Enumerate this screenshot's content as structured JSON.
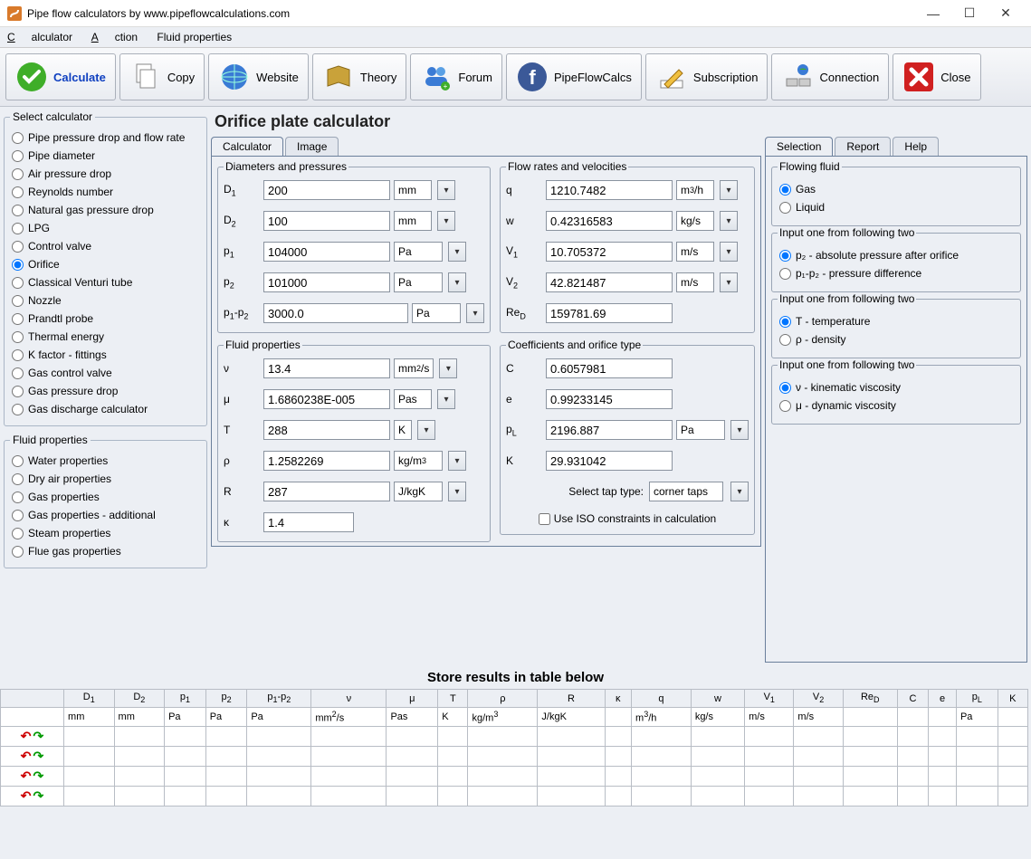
{
  "window": {
    "title": "Pipe flow calculators by www.pipeflowcalculations.com"
  },
  "menu": {
    "calculator": "Calculator",
    "action": "Action",
    "fluid": "Fluid properties"
  },
  "toolbar": {
    "calculate": "Calculate",
    "copy": "Copy",
    "website": "Website",
    "theory": "Theory",
    "forum": "Forum",
    "pipeflowcalcs": "PipeFlowCalcs",
    "subscription": "Subscription",
    "connection": "Connection",
    "close": "Close"
  },
  "sidebar": {
    "selectCalc": "Select calculator",
    "calcs": [
      "Pipe pressure drop and flow rate",
      "Pipe diameter",
      "Air pressure drop",
      "Reynolds number",
      "Natural gas pressure drop",
      "LPG",
      "Control valve",
      "Orifice",
      "Classical Venturi tube",
      "Nozzle",
      "Prandtl probe",
      "Thermal energy",
      "K factor - fittings",
      "Gas control valve",
      "Gas pressure drop",
      "Gas discharge calculator"
    ],
    "selectedCalc": "Orifice",
    "fluidProps": "Fluid properties",
    "fluids": [
      "Water properties",
      "Dry air properties",
      "Gas properties",
      "Gas properties - additional",
      "Steam properties",
      "Flue gas properties"
    ]
  },
  "main": {
    "title": "Orifice plate calculator",
    "tabCalc": "Calculator",
    "tabImage": "Image",
    "diameters": {
      "legend": "Diameters and pressures",
      "D1": "200",
      "D1u": "mm",
      "D2": "100",
      "D2u": "mm",
      "p1": "104000",
      "p1u": "Pa",
      "p2": "101000",
      "p2u": "Pa",
      "dp": "3000.0",
      "dpu": "Pa"
    },
    "flowrates": {
      "legend": "Flow rates and velocities",
      "q": "1210.7482",
      "qu": "m³/h",
      "w": "0.42316583",
      "wu": "kg/s",
      "V1": "10.705372",
      "V1u": "m/s",
      "V2": "42.821487",
      "V2u": "m/s",
      "ReD": "159781.69"
    },
    "fluidprops": {
      "legend": "Fluid properties",
      "nu": "13.4",
      "nuu": "mm²/s",
      "mu": "1.6860238E-005",
      "muu": "Pas",
      "T": "288",
      "Tu": "K",
      "rho": "1.2582269",
      "rhou": "kg/m³",
      "R": "287",
      "Ru": "J/kgK",
      "kappa": "1.4"
    },
    "coeffs": {
      "legend": "Coefficients and orifice type",
      "C": "0.6057981",
      "e": "0.99233145",
      "pL": "2196.887",
      "pLu": "Pa",
      "K": "29.931042",
      "taplabel": "Select tap type:",
      "tap": "corner taps",
      "iso": "Use ISO constraints in calculation"
    }
  },
  "right": {
    "tabSel": "Selection",
    "tabRep": "Report",
    "tabHelp": "Help",
    "flowing": "Flowing fluid",
    "gas": "Gas",
    "liquid": "Liquid",
    "inp1": "Input one from following two",
    "p2abs": "p₂ - absolute pressure after orifice",
    "pdiff": "p₁-p₂ - pressure difference",
    "inp2": "Input one from following two",
    "Ttemp": "T - temperature",
    "rhod": "ρ - density",
    "inp3": "Input one from following two",
    "nuk": "ν - kinematic viscosity",
    "mud": "μ - dynamic viscosity"
  },
  "results": {
    "title": "Store results in table below",
    "headers": [
      "",
      "D₁",
      "D₂",
      "p₁",
      "p₂",
      "p₁-p₂",
      "ν",
      "μ",
      "T",
      "ρ",
      "R",
      "κ",
      "q",
      "w",
      "V₁",
      "V₂",
      "Re_D",
      "C",
      "e",
      "p_L",
      "K"
    ],
    "units": [
      "",
      "mm",
      "mm",
      "Pa",
      "Pa",
      "Pa",
      "mm²/s",
      "Pas",
      "K",
      "kg/m³",
      "J/kgK",
      "",
      "m³/h",
      "kg/s",
      "m/s",
      "m/s",
      "",
      "",
      "",
      "Pa",
      ""
    ]
  }
}
